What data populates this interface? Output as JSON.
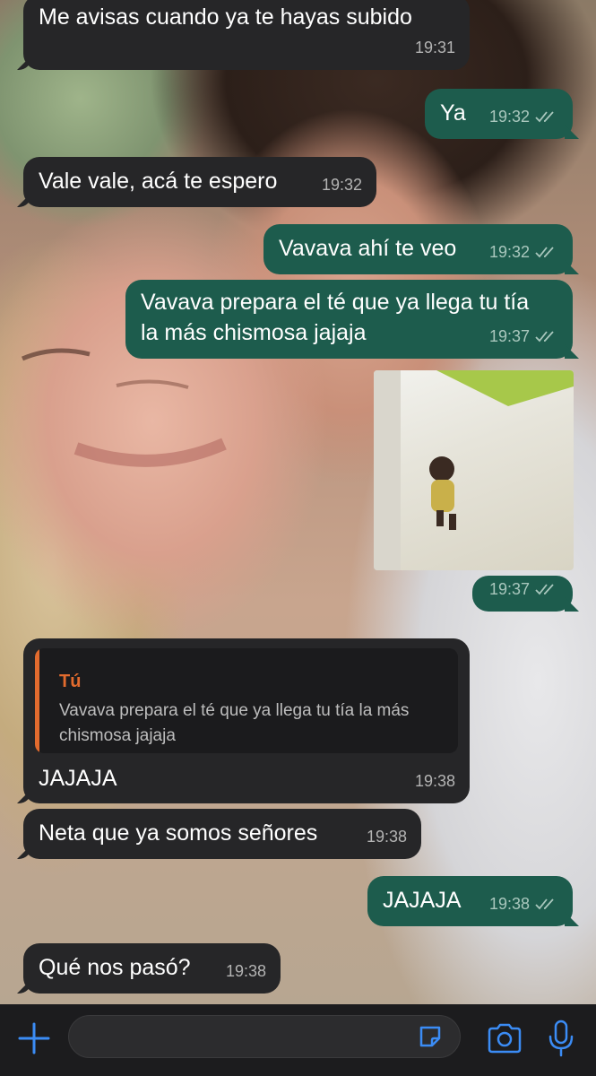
{
  "messages": [
    {
      "side": "in",
      "text": "Me avisas cuando ya te hayas subido",
      "time": "19:31"
    },
    {
      "side": "out",
      "text": "Ya",
      "time": "19:32"
    },
    {
      "side": "in",
      "text": "Vale vale, acá te espero",
      "time": "19:32"
    },
    {
      "side": "out",
      "text": "Vavava ahí te veo",
      "time": "19:32"
    },
    {
      "side": "out",
      "text": "Vavava prepara el té que ya llega tu tía\nla más chismosa jajaja",
      "time": "19:37"
    },
    {
      "side": "out",
      "type": "image",
      "time": "19:37"
    },
    {
      "side": "in",
      "text": "JAJAJA",
      "time": "19:38",
      "reply": {
        "author": "Tú",
        "text": "Vavava prepara el té que ya llega tu tía la más chismosa jajaja"
      }
    },
    {
      "side": "in",
      "text": "Neta que ya somos señores",
      "time": "19:38"
    },
    {
      "side": "out",
      "text": "JAJAJA",
      "time": "19:38"
    },
    {
      "side": "in",
      "text": "Qué nos pasó?",
      "time": "19:38"
    }
  ],
  "input_bar": {
    "placeholder": ""
  },
  "icons": {
    "attach": "plus-icon",
    "sticker": "sticker-icon",
    "camera": "camera-icon",
    "mic": "microphone-icon",
    "read_receipt": "double-check-icon"
  },
  "colors": {
    "incoming_bubble": "#262628",
    "outgoing_bubble": "#1d5c4d",
    "accent": "#3b8cf5",
    "reply_author": "#e26b2e"
  }
}
